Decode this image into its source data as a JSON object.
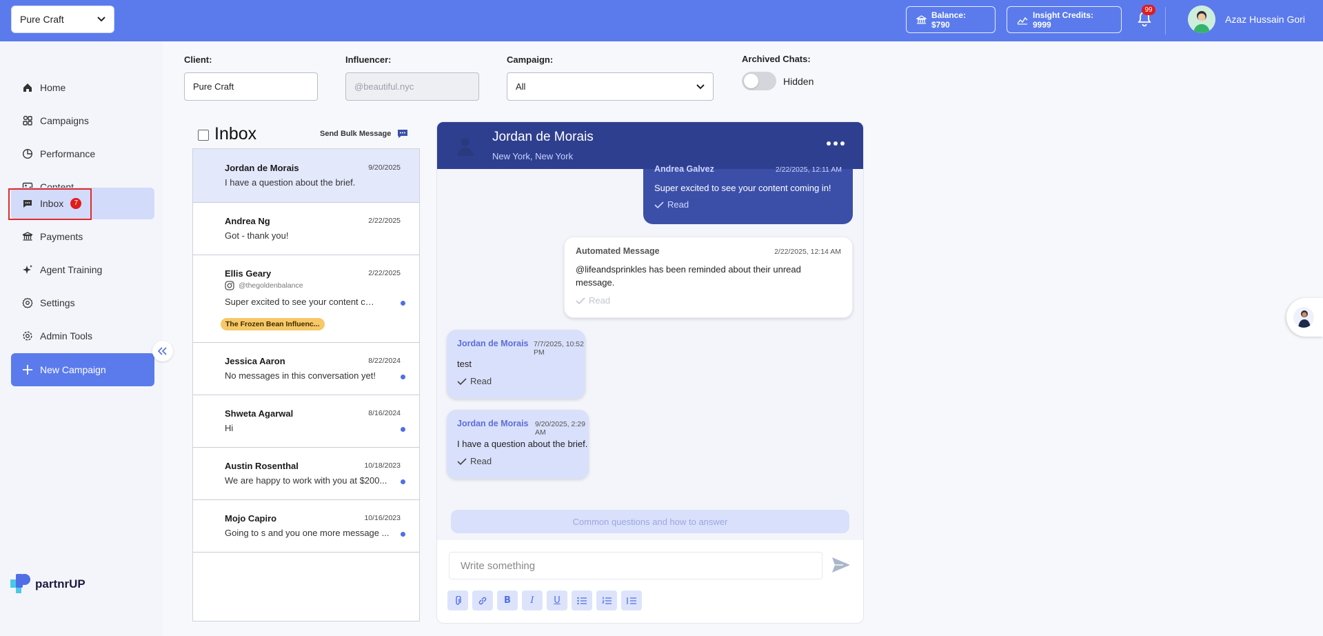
{
  "topbar": {
    "brand_select": "Pure Craft",
    "balance": "Balance: $790",
    "credits": "Insight Credits: 9999",
    "notification_count": "99",
    "user_name": "Azaz Hussain Gori"
  },
  "sidebar": {
    "items": [
      {
        "label": "Home",
        "icon": "home-icon"
      },
      {
        "label": "Campaigns",
        "icon": "campaigns-icon"
      },
      {
        "label": "Performance",
        "icon": "pie-chart-icon"
      },
      {
        "label": "Content",
        "icon": "image-icon"
      },
      {
        "label": "Inbox",
        "icon": "chat-icon",
        "badge": "7",
        "active": true
      },
      {
        "label": "Payments",
        "icon": "bank-icon"
      },
      {
        "label": "Agent Training",
        "icon": "sparkle-icon"
      },
      {
        "label": "Settings",
        "icon": "gear-icon"
      },
      {
        "label": "Admin Tools",
        "icon": "admin-gear-icon"
      }
    ],
    "new_campaign": "New Campaign",
    "logo_text": "partnrUP"
  },
  "filters": {
    "client_label": "Client:",
    "client_value": "Pure Craft",
    "influencer_label": "Influencer:",
    "influencer_placeholder": "@beautiful.nyc",
    "campaign_label": "Campaign:",
    "campaign_value": "All",
    "archived_label": "Archived Chats:",
    "archived_state": "Hidden"
  },
  "inbox": {
    "title": "Inbox",
    "bulk_label": "Send Bulk Message",
    "conversations": [
      {
        "name": "Jordan de Morais",
        "date": "9/20/2025",
        "preview": "I have a question about the brief.",
        "selected": true,
        "unread": false
      },
      {
        "name": "Andrea Ng",
        "date": "2/22/2025",
        "preview": "Got - thank you!",
        "unread": false
      },
      {
        "name": "Ellis Geary",
        "date": "2/22/2025",
        "handle": "@thegoldenbalance",
        "preview": "Super excited to see your content coming in!",
        "tag": "The Frozen Bean Influenc...",
        "unread": true
      },
      {
        "name": "Jessica Aaron",
        "date": "8/22/2024",
        "preview": "No messages in this conversation yet!",
        "unread": true
      },
      {
        "name": "Shweta Agarwal",
        "date": "8/16/2024",
        "preview": "Hi",
        "unread": true
      },
      {
        "name": "Austin Rosenthal",
        "date": "10/18/2023",
        "preview": "We are happy to work with you at $200...",
        "unread": true
      },
      {
        "name": "Mojo Capiro",
        "date": "10/16/2023",
        "preview": "Going to s and you one more message ...",
        "unread": true
      }
    ]
  },
  "chat": {
    "name": "Jordan de Morais",
    "location": "New York, New York",
    "messages": [
      {
        "sender": "Andrea Galvez",
        "time": "2/22/2025, 12:11 AM",
        "text": "Super excited to see your content coming in!",
        "status": "Read"
      },
      {
        "sender": "Automated Message",
        "time": "2/22/2025, 12:14 AM",
        "text_line1": "@lifeandsprinkles has been reminded about their unread",
        "text_line2": "message.",
        "status": "Read"
      },
      {
        "sender": "Jordan de Morais",
        "time": "7/7/2025, 10:52 PM",
        "text": "test",
        "status": "Read"
      },
      {
        "sender": "Jordan de Morais",
        "time": "9/20/2025, 2:29 AM",
        "text": "I have a question about the brief.",
        "status": "Read"
      }
    ],
    "faq_button": "Common questions and how to answer",
    "compose_placeholder": "Write something",
    "toolbar": [
      "attach-icon",
      "link-icon",
      "bold-icon",
      "italic-icon",
      "underline-icon",
      "bullet-list-icon",
      "numbered-list-icon",
      "indent-list-icon"
    ]
  },
  "colors": {
    "brand": "#5b7bec",
    "chat_header": "#2f3f8f",
    "badge": "#e01c1c",
    "tag": "#f7c868"
  }
}
